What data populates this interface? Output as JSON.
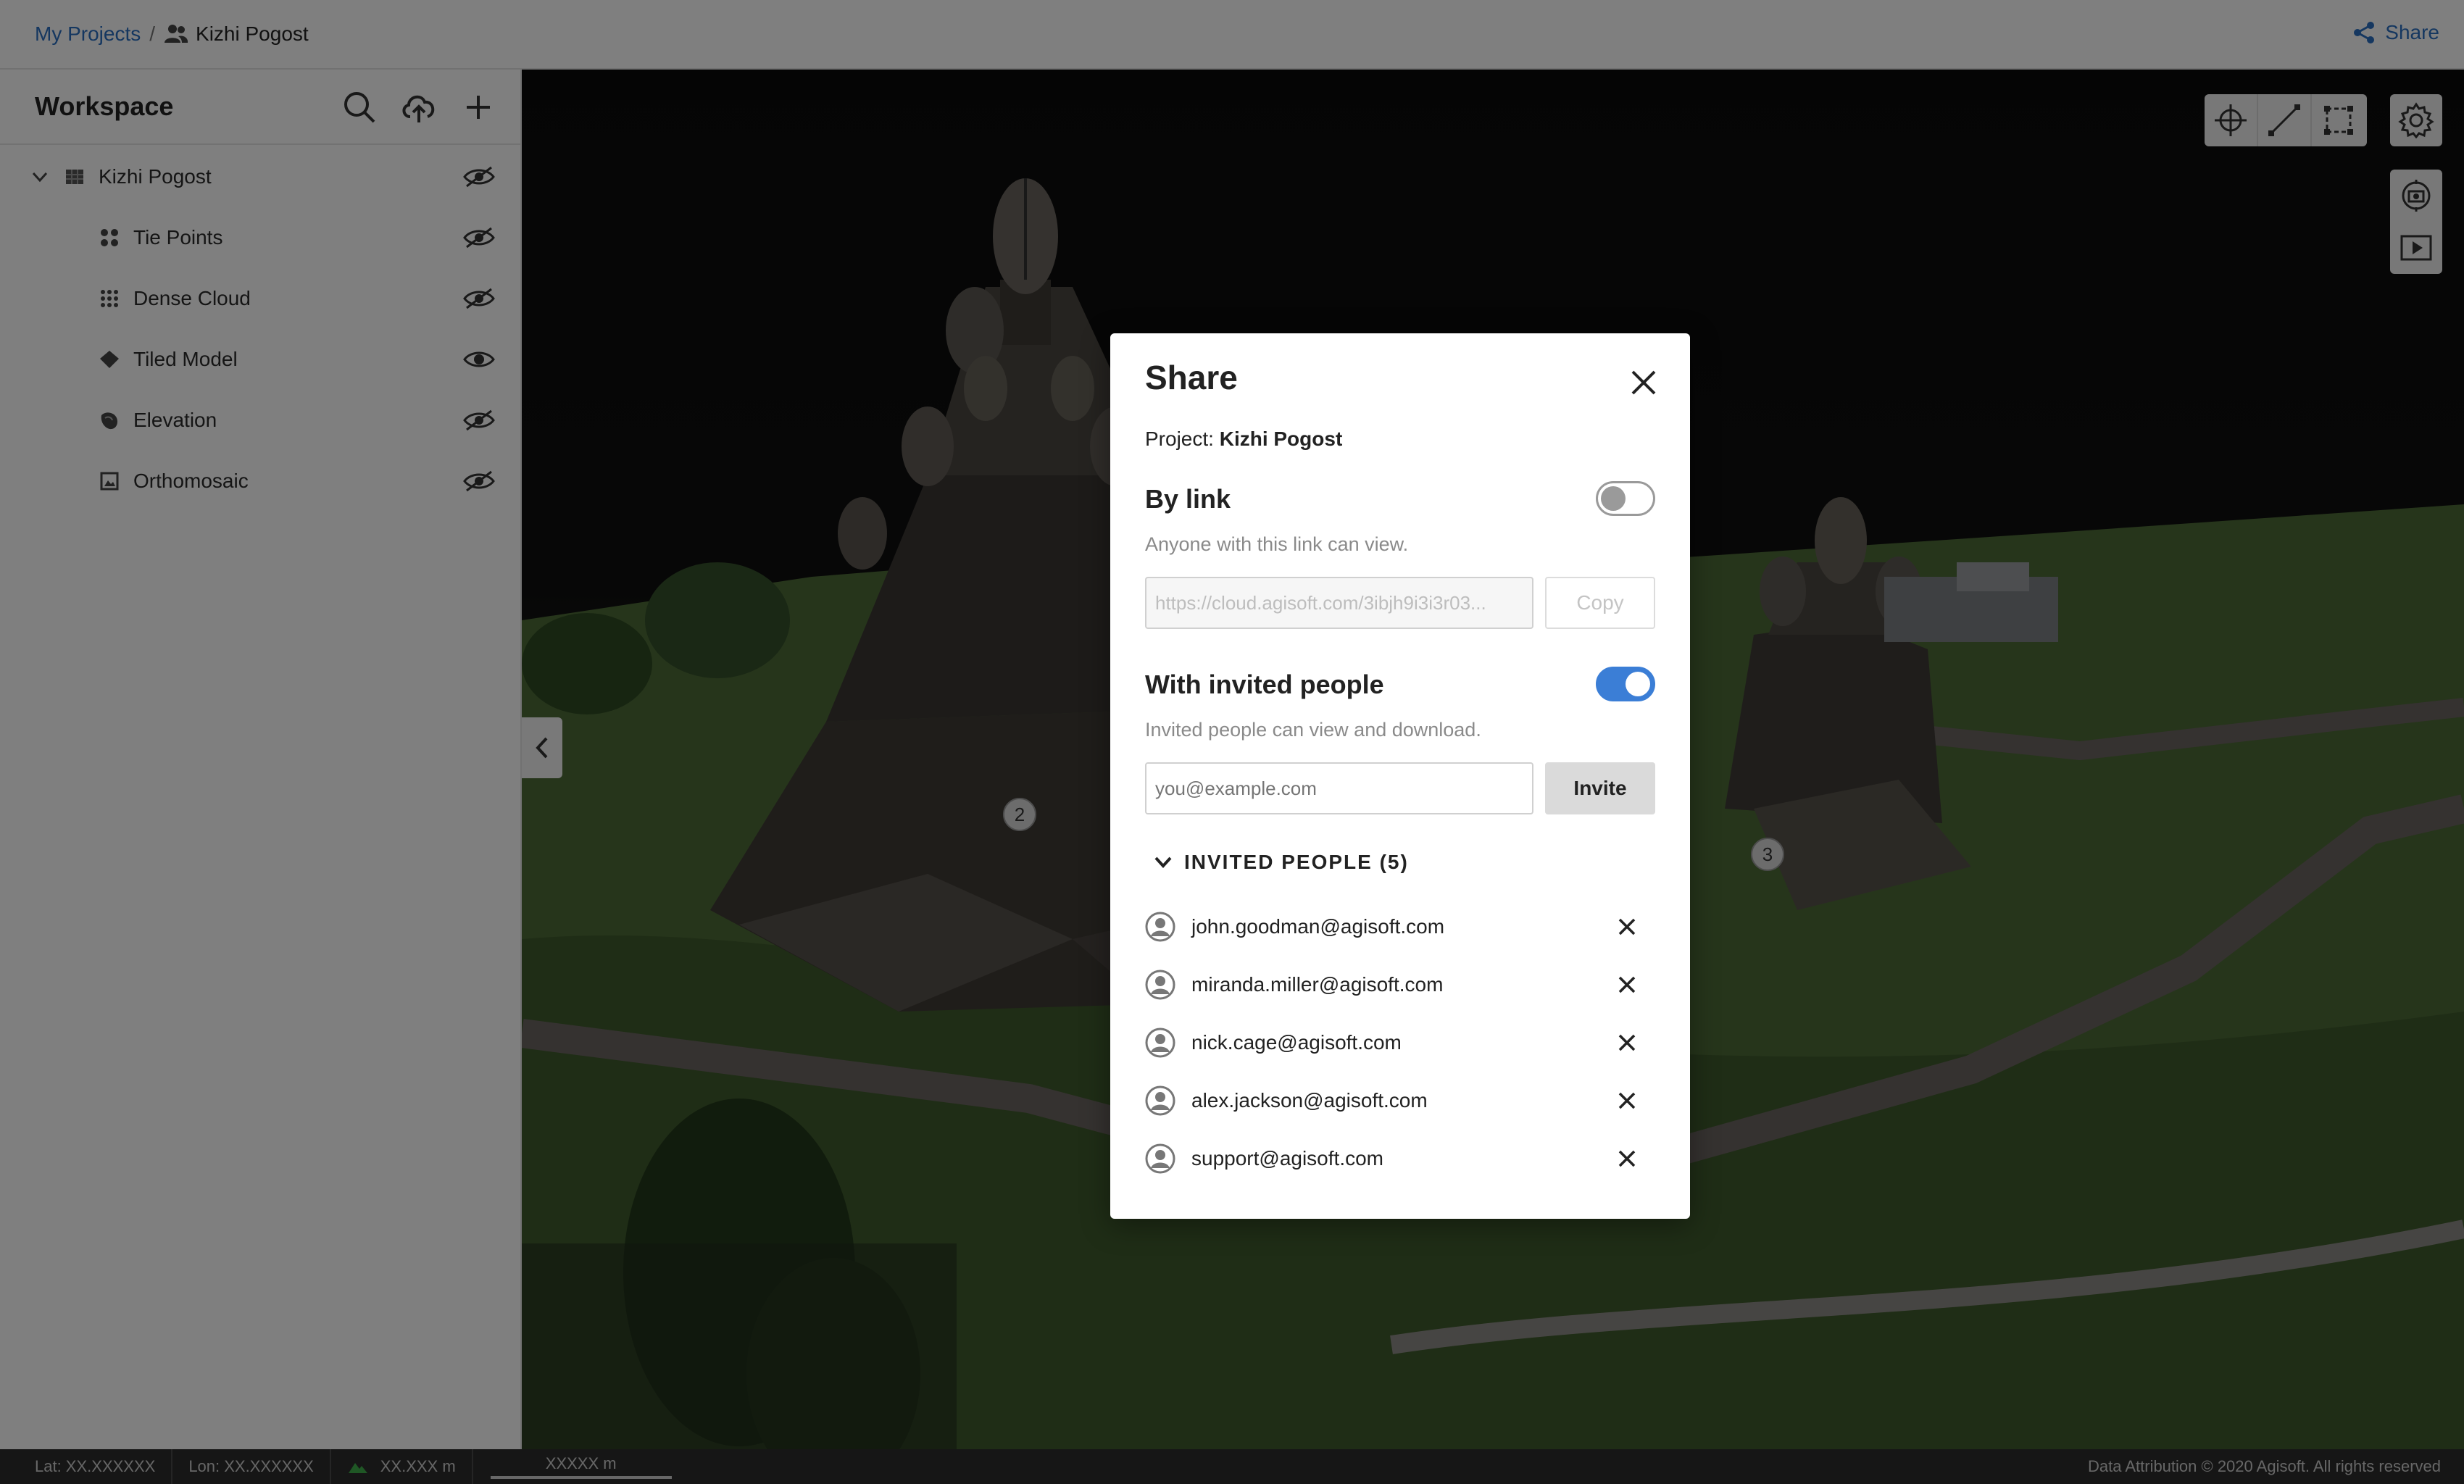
{
  "breadcrumb": {
    "root": "My Projects",
    "separator": "/",
    "current": "Kizhi Pogost"
  },
  "topbar": {
    "share_label": "Share",
    "accent_color": "#2a6fc0"
  },
  "workspace": {
    "title": "Workspace",
    "tools": [
      "search-icon",
      "upload-icon",
      "plus-icon"
    ],
    "root": {
      "label": "Kizhi Pogost",
      "visible": false
    },
    "layers": [
      {
        "label": "Tie Points",
        "icon": "tie-points-icon",
        "visible": false
      },
      {
        "label": "Dense Cloud",
        "icon": "dense-cloud-icon",
        "visible": false
      },
      {
        "label": "Tiled Model",
        "icon": "tiled-model-icon",
        "visible": true
      },
      {
        "label": "Elevation",
        "icon": "elevation-icon",
        "visible": false
      },
      {
        "label": "Orthomosaic",
        "icon": "orthomosaic-icon",
        "visible": false
      }
    ]
  },
  "viewport": {
    "markers": [
      "2",
      "3"
    ],
    "tools": [
      "crosshair-icon",
      "ruler-icon",
      "polygon-icon"
    ],
    "settings_icon": "gear-icon",
    "side_tools": [
      "camera-reset-icon",
      "play-icon"
    ]
  },
  "statusbar": {
    "lat": "Lat: XX.XXXXXX",
    "lon": "Lon: XX.XXXXXX",
    "alt": "XX.XXX m",
    "scale": "XXXXX m",
    "attribution": "Data Attribution © 2020 Agisoft. All rights reserved"
  },
  "share_dialog": {
    "title": "Share",
    "project_prefix": "Project:",
    "project_name": "Kizhi Pogost",
    "by_link": {
      "title": "By link",
      "enabled": false,
      "description": "Anyone with this link can view.",
      "url": "https://cloud.agisoft.com/3ibjh9i3i3r03...",
      "copy_label": "Copy"
    },
    "invited": {
      "title": "With invited people",
      "enabled": true,
      "description": "Invited people can view and download.",
      "email_placeholder": "you@example.com",
      "invite_label": "Invite",
      "list_header": "INVITED PEOPLE (5)",
      "people": [
        "john.goodman@agisoft.com",
        "miranda.miller@agisoft.com",
        "nick.cage@agisoft.com",
        "alex.jackson@agisoft.com",
        "support@agisoft.com"
      ]
    },
    "toggle_on_color": "#3b7ed6"
  }
}
